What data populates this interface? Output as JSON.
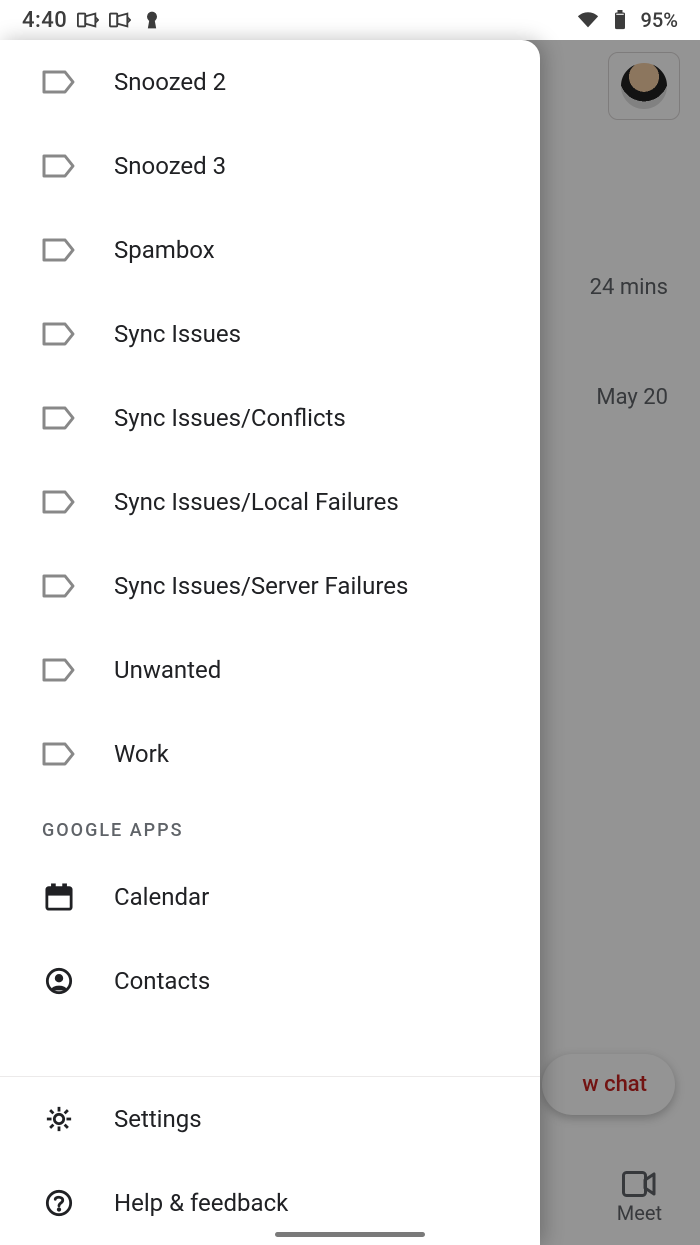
{
  "status": {
    "time": "4:40",
    "battery_pct": "95%"
  },
  "drawer": {
    "labels": [
      {
        "label": "Snoozed 2"
      },
      {
        "label": "Snoozed 3"
      },
      {
        "label": "Spambox"
      },
      {
        "label": "Sync Issues"
      },
      {
        "label": "Sync Issues/Conflicts"
      },
      {
        "label": "Sync Issues/Local Failures"
      },
      {
        "label": "Sync Issues/Server Failures"
      },
      {
        "label": "Unwanted"
      },
      {
        "label": "Work"
      }
    ],
    "section": "Google Apps",
    "apps": [
      {
        "label": "Calendar"
      },
      {
        "label": "Contacts"
      }
    ],
    "bottom": [
      {
        "label": "Settings"
      },
      {
        "label": "Help & feedback"
      }
    ]
  },
  "background": {
    "times": [
      "24 mins",
      "May 20"
    ],
    "new_chat": "w chat",
    "meet": "Meet"
  }
}
